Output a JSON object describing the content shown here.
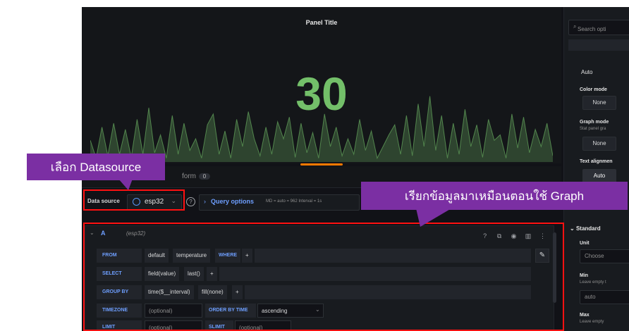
{
  "panel": {
    "title": "Panel Title",
    "value": "30",
    "value_color": "#73bf69",
    "series_color": "#73bf69"
  },
  "sparkline": [
    0.28,
    0.05,
    0.45,
    0.08,
    0.5,
    0.1,
    0.42,
    0.06,
    0.55,
    0.1,
    0.7,
    0.12,
    0.35,
    0.05,
    0.6,
    0.1,
    0.5,
    0.15,
    0.3,
    0.05,
    0.48,
    0.62,
    0.1,
    0.4,
    0.05,
    0.55,
    0.2,
    0.65,
    0.3,
    0.08,
    0.45,
    0.1,
    0.52,
    0.3,
    0.58,
    0.06,
    0.5,
    0.12,
    0.38,
    0.05,
    0.62,
    0.2,
    0.45,
    0.08,
    0.3,
    0.1,
    0.55,
    0.15,
    0.4,
    0.05,
    0.2,
    0.35,
    0.48,
    0.1,
    0.6,
    0.08,
    0.75,
    0.2,
    0.85,
    0.15,
    0.6,
    0.05,
    0.5,
    0.1,
    0.68,
    0.2,
    0.48,
    0.06,
    0.55,
    0.28,
    0.35,
    0.05,
    0.62,
    0.18,
    0.58,
    0.12,
    0.42,
    0.2,
    0.5,
    0.08
  ],
  "tabs": {
    "transform_label": "form",
    "transform_count": "0"
  },
  "toolbar": {
    "datasource_label": "Data source",
    "datasource_name": "esp32",
    "caret": "⌄",
    "help": "?",
    "query_options_label": "Query options",
    "query_options_meta": "MD = auto = 962   Interval = 1s"
  },
  "query": {
    "ref_id": "A",
    "datasource": "(esp32)",
    "rows": [
      {
        "keyword": "FROM",
        "segments": [
          "default",
          "temperature",
          "WHERE",
          "+"
        ]
      },
      {
        "keyword": "SELECT",
        "segments": [
          "field(value)",
          "last()",
          "+"
        ]
      },
      {
        "keyword": "GROUP BY",
        "segments": [
          "time($__interval)",
          "fill(none)",
          "+"
        ]
      },
      {
        "keyword": "TIMEZONE",
        "segments": [
          "(optional)",
          "ORDER BY TIME",
          "ascending"
        ]
      },
      {
        "keyword": "LIMIT",
        "segments": [
          "(optional)",
          "SLIMIT",
          "(optional)"
        ]
      }
    ]
  },
  "options_pane": {
    "search_placeholder": "Search opti",
    "auto_value": "Auto",
    "color_mode_label": "Color mode",
    "color_mode_value": "None",
    "graph_mode_label": "Graph mode",
    "graph_mode_sub": "Stat panel gra",
    "graph_mode_value": "None",
    "text_alignment_label": "Text alignmen",
    "text_alignment_value": "Auto",
    "standard_section": "Standard",
    "unit_label": "Unit",
    "unit_value": "Choose",
    "min_label": "Min",
    "min_sub": "Leave empty t",
    "min_value": "auto",
    "max_label": "Max",
    "max_sub": "Leave empty"
  },
  "annotations": {
    "datasource_callout": "เลือก Datasource",
    "graph_callout": "เรียกข้อมูลมาเหมือนตอนใช้ Graph",
    "callout_color": "#7b2fa3",
    "box_color": "#ff1111"
  }
}
